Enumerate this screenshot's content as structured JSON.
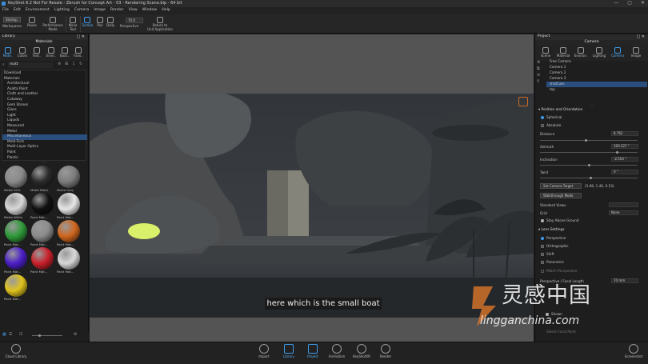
{
  "title_bar": {
    "title": "KeyShot 8.2 Not For Resale  -  Zbrush for Concept Art - 03 - Rendering Scene.bip  -  64 bit",
    "minimize": "—",
    "maximize": "▢",
    "close": "✕"
  },
  "menu": [
    "File",
    "Edit",
    "Environment",
    "Lighting",
    "Camera",
    "Image",
    "Render",
    "View",
    "Window",
    "Help"
  ],
  "toolbar": {
    "workspace_select": "Startup",
    "cpu_value": "70.0",
    "workspaces": "Workspaces",
    "pause": "Pause",
    "performance_mode": "Performance\nMode",
    "move_tool": "Move\nTool",
    "tumble": "Tumble",
    "pan": "Pan",
    "dolly": "Dolly",
    "perspective": "Perspective",
    "return_to": "Return to\nUnit Application"
  },
  "library": {
    "header": "Library",
    "tab_title": "Materials",
    "tabs": [
      "Mate..",
      "Colors",
      "Text..",
      "Envir..",
      "Back..",
      "Favo.."
    ],
    "search_value": "matt",
    "tree": [
      {
        "label": "Download",
        "top": true
      },
      {
        "label": "Materials",
        "top": true
      },
      {
        "label": "Architectural"
      },
      {
        "label": "Axalta Paint"
      },
      {
        "label": "Cloth and Leather"
      },
      {
        "label": "Cutaway"
      },
      {
        "label": "Gem Stones"
      },
      {
        "label": "Glass"
      },
      {
        "label": "Light"
      },
      {
        "label": "Liquids"
      },
      {
        "label": "Measured"
      },
      {
        "label": "Metal"
      },
      {
        "label": "Miscellaneous",
        "selected": true
      },
      {
        "label": "Mold-Tech"
      },
      {
        "label": "Multi-Layer Optics"
      },
      {
        "label": "Paint"
      },
      {
        "label": "Plastic"
      }
    ],
    "materials": [
      {
        "label": "Matte 50%",
        "color": "#8a8a8a"
      },
      {
        "label": "Matte Black",
        "color": "#2a2a2a"
      },
      {
        "label": "Matte Grey",
        "color": "#7c7c7c"
      },
      {
        "label": "Matte White",
        "color": "#d8d8d8"
      },
      {
        "label": "Paint Mat...",
        "color": "#111111"
      },
      {
        "label": "Paint Mat...",
        "color": "#e6e6e6"
      },
      {
        "label": "Paint Mat...",
        "color": "#2f9a3a"
      },
      {
        "label": "Paint Mat...",
        "color": "#8c8c8c"
      },
      {
        "label": "Paint Mat...",
        "color": "#d0661e"
      },
      {
        "label": "Paint Mat...",
        "color": "#4b1fc8"
      },
      {
        "label": "Paint Mat...",
        "color": "#c8202a"
      },
      {
        "label": "Paint Mat...",
        "color": "#d8d8d8"
      },
      {
        "label": "Paint Mat...",
        "color": "#e0c31e"
      }
    ]
  },
  "viewport": {
    "subtitle": "here which is the small boat"
  },
  "project": {
    "header": "Project",
    "tab_title": "Camera",
    "tabs": [
      "Scene",
      "Material",
      "Environ.",
      "Lighting",
      "Camera",
      "Image"
    ],
    "cameras": [
      {
        "label": "Free Camera"
      },
      {
        "label": "Camera 1"
      },
      {
        "label": "Camera 2"
      },
      {
        "label": "Camera 3"
      },
      {
        "label": "shotCam",
        "selected": true
      },
      {
        "label": "top"
      }
    ],
    "position_title": "Position and Orientation",
    "spherical": "Spherical",
    "absolute": "Absolute",
    "distance_label": "Distance",
    "distance_value": "8.762",
    "azimuth_label": "Azimuth",
    "azimuth_value": "100.327 °",
    "inclination_label": "Inclination",
    "inclination_value": "-2.554 °",
    "twist_label": "Twist",
    "twist_value": "0 °",
    "set_camera_target": "Set Camera Target",
    "target_coords": "(5.68, 1.46, 0.53)",
    "walkthrough": "Walkthrough Mode",
    "standard_views": "Standard Views",
    "grid_label": "Grid",
    "grid_value": "None",
    "stay_above_ground": "Stay Above Ground",
    "lens_title": "Lens Settings",
    "lens_options": [
      "Perspective",
      "Orthographic",
      "Shift",
      "Panoramic"
    ],
    "match_perspective": "Match Perspective",
    "focal_label": "Perspective / Focal Length",
    "focal_value": "70 mm",
    "shown": "Shown",
    "select_focal_point": "Select Focal Point"
  },
  "bottom_bar": {
    "cloud_library": "Cloud Library",
    "import": "Import",
    "library": "Library",
    "project": "Project",
    "animation": "Animation",
    "keyshotxr": "KeyShotXR",
    "render": "Render",
    "screenshot": "Screenshot"
  },
  "watermark": {
    "brand_cn": "灵感中国",
    "domain": "lingganchina.com",
    "colors": {
      "brand_orange": "#e0782a",
      "text_white": "#ffffff"
    }
  }
}
